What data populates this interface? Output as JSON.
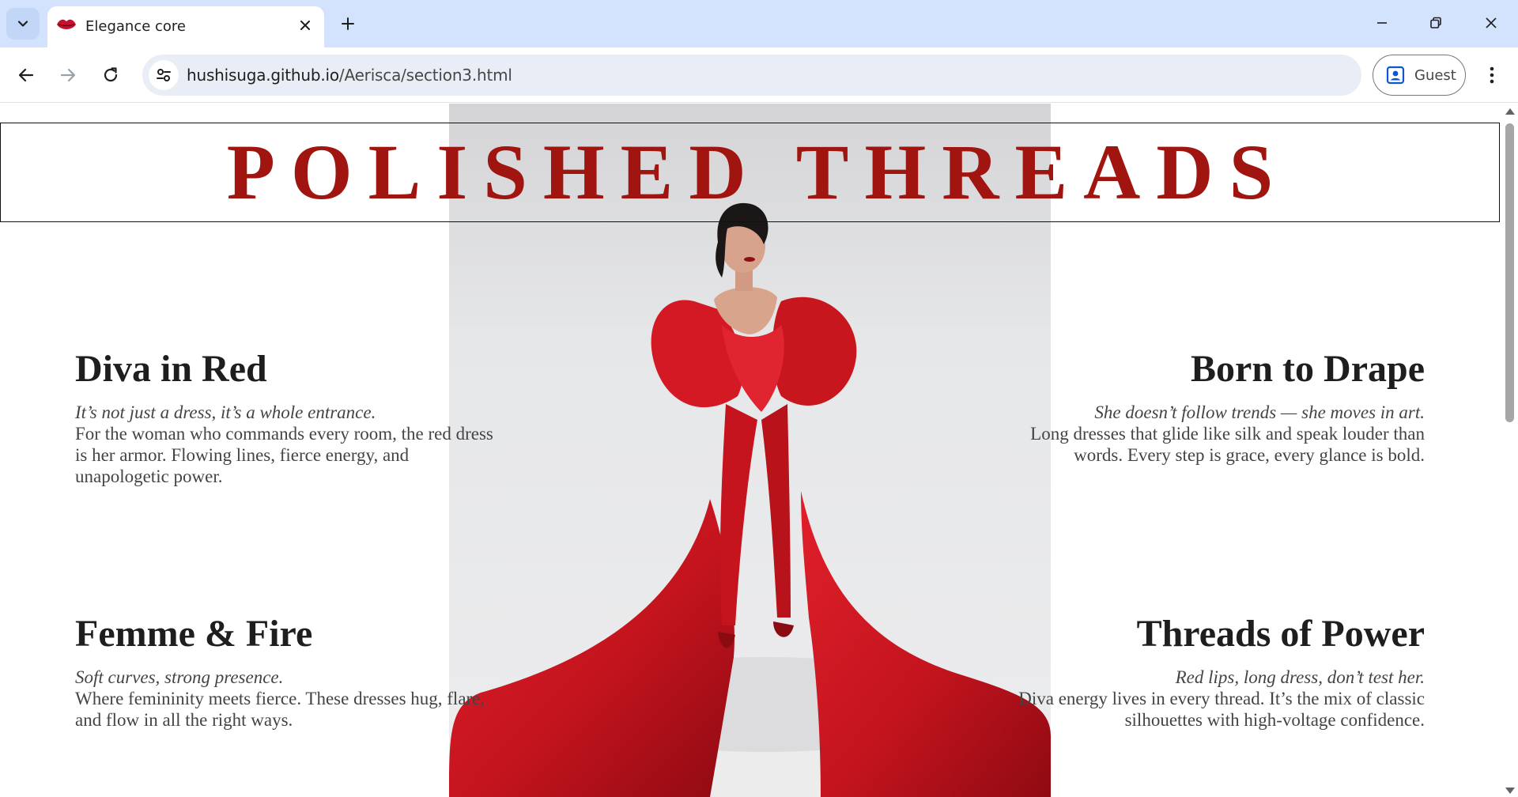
{
  "browser": {
    "tab_title": "Elegance core",
    "url_host": "hushisuga.github.io",
    "url_path": "/Aerisca/section3.html",
    "profile_label": "Guest"
  },
  "page": {
    "banner_title": "POLISHED THREADS",
    "accent_color": "#a11510",
    "blocks": [
      {
        "title": "Diva in Red",
        "tagline": "It’s not just a dress, it’s a whole entrance.",
        "body": "For the woman who commands every room, the red dress is her armor. Flowing lines, fierce energy, and unapologetic power."
      },
      {
        "title": "Born to Drape",
        "tagline": "She doesn’t follow trends — she moves in art.",
        "body": "Long dresses that glide like silk and speak louder than words. Every step is grace, every glance is bold."
      },
      {
        "title": "Femme & Fire",
        "tagline": "Soft curves, strong presence.",
        "body": "Where femininity meets fierce. These dresses hug, flare, and flow in all the right ways."
      },
      {
        "title": "Threads of Power",
        "tagline": "Red lips, long dress, don’t test her.",
        "body": "Diva energy lives in every thread. It’s the mix of classic silhouettes with high-voltage confidence."
      }
    ]
  }
}
